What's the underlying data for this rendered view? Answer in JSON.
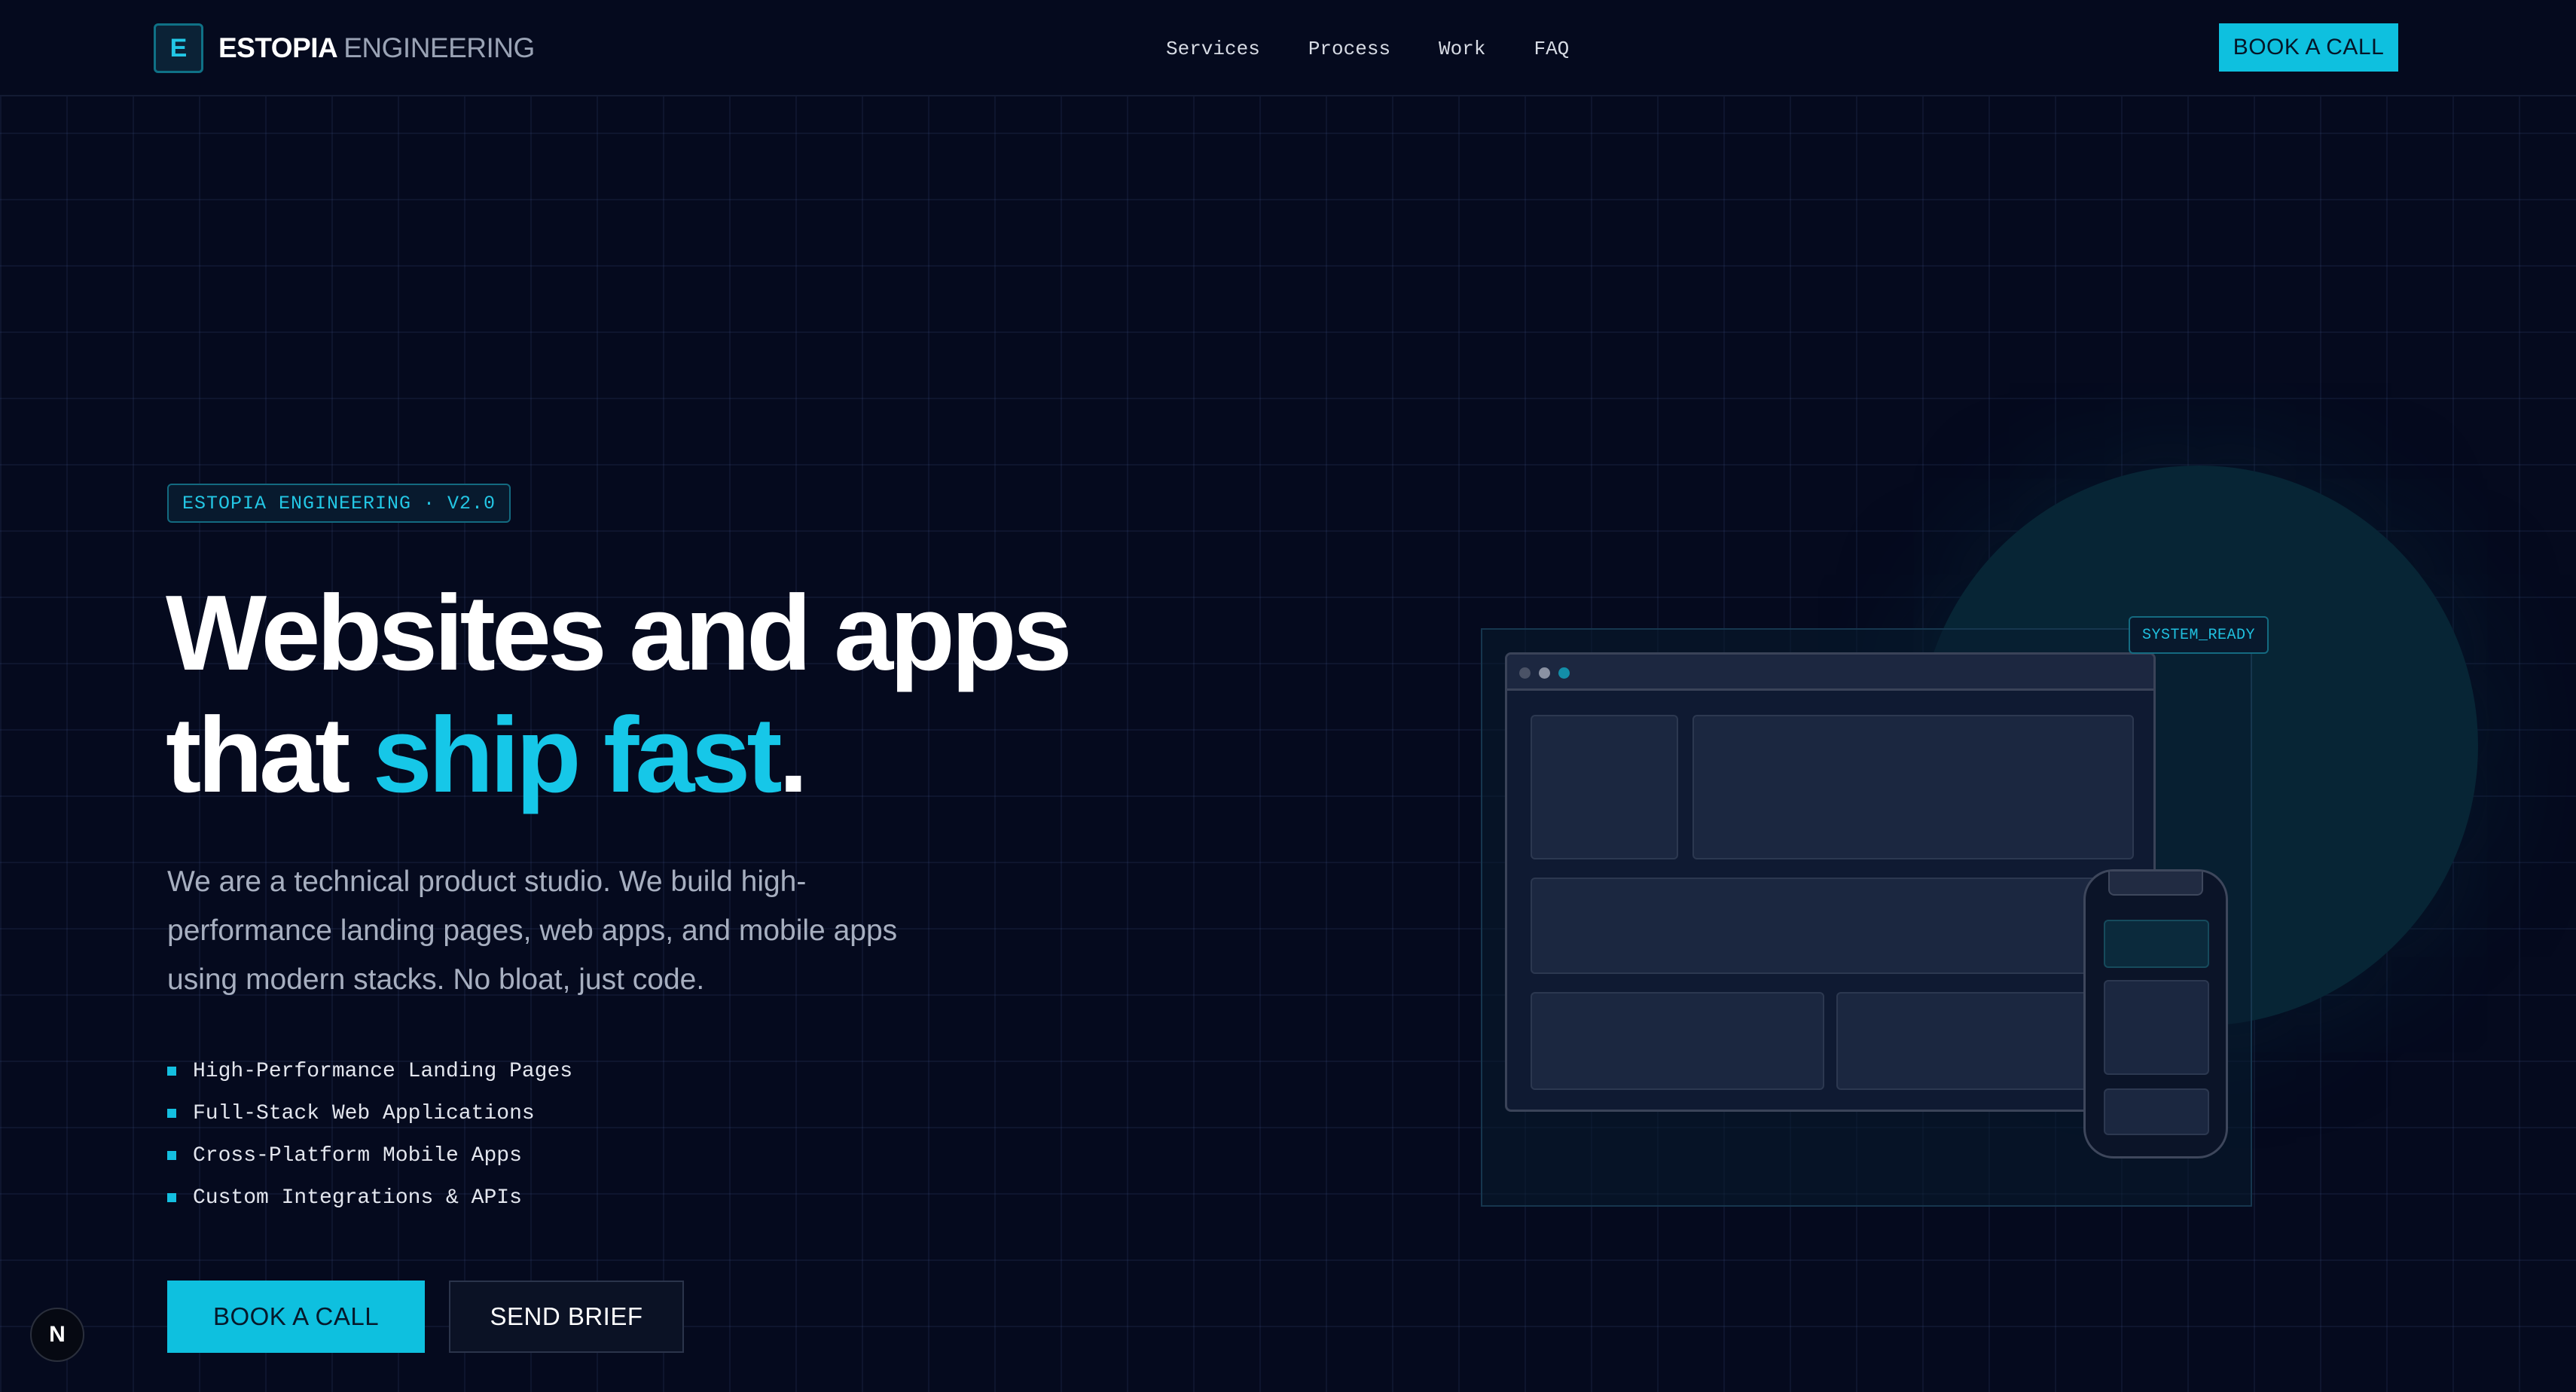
{
  "nav": {
    "logo_letter": "E",
    "brand_name": "ESTOPIA",
    "brand_suffix": "ENGINEERING",
    "links": [
      {
        "label": "Services"
      },
      {
        "label": "Process"
      },
      {
        "label": "Work"
      },
      {
        "label": "FAQ"
      }
    ],
    "cta_label": "BOOK A CALL"
  },
  "hero": {
    "badge": "ESTOPIA ENGINEERING · V2.0",
    "headline_line1": "Websites and apps",
    "headline_line2_prefix": "that ",
    "headline_line2_accent": "ship fast",
    "headline_line2_suffix": ".",
    "lead": "We are a technical product studio. We build high-performance landing pages, web apps, and mobile apps using modern stacks. No bloat, just code.",
    "features": [
      "High-Performance Landing Pages",
      "Full-Stack Web Applications",
      "Cross-Platform Mobile Apps",
      "Custom Integrations & APIs"
    ],
    "primary_cta": "BOOK A CALL",
    "secondary_cta": "SEND BRIEF"
  },
  "illustration": {
    "status_tag": "SYSTEM_READY"
  },
  "dev_badge": "N",
  "colors": {
    "background": "#050a1e",
    "accent": "#0ec0df",
    "text_primary": "#ffffff",
    "text_muted": "#a7afc0"
  }
}
